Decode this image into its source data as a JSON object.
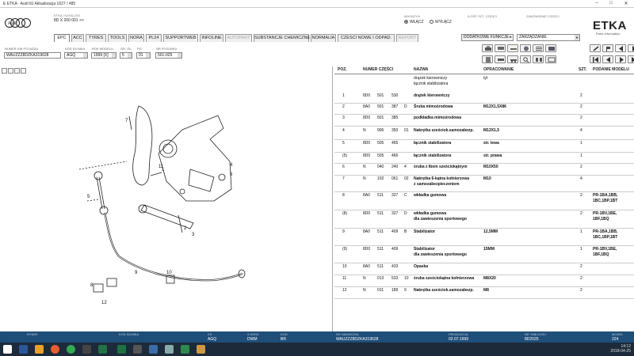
{
  "titlebar": {
    "text": "E ETKA · Audi 8J Aktualizacja 1627 / 485",
    "minimize": "–",
    "maximize": "□",
    "close": "✕"
  },
  "header": {
    "brand": "Audi",
    "model_label": "ETKA / KATALOGI",
    "model_value": "8D X 200 001 >>",
    "market_label": "MAGAZYN",
    "market_on": "WŁĄCZ",
    "market_off": "WYŁĄCZ",
    "parts_label": "ILOŚĆ SZT. CZĘŚCI",
    "order_label": "ZAMÓWIENIE CZĘŚCI",
    "etka_logo": "ETKA",
    "etka_sub": "Parts Information"
  },
  "tabs": [
    {
      "label": "EPC",
      "active": true
    },
    {
      "label": "ACC"
    },
    {
      "label": "TYRES"
    },
    {
      "label": "TOOLS"
    },
    {
      "label": "NORA"
    },
    {
      "label": "PL24"
    },
    {
      "label": "SUPPORTWEB"
    },
    {
      "label": "INFOLINE"
    },
    {
      "label": "AUTOPART",
      "disabled": true
    },
    {
      "label": "SUBSTANCJE CHEMICZNE"
    },
    {
      "label": "NORMALIA"
    },
    {
      "label": "CZESCI NOWE I ODPAD."
    },
    {
      "label": "REPORT",
      "disabled": true
    }
  ],
  "functions": {
    "label": "DODATKOWE FUNKCJE ▸",
    "manage": "ZARZĄDZANIE"
  },
  "filters": {
    "vin_label": "NUMER VIN POJAZDU",
    "vin_value": "WAUZZZ8DZKA319628",
    "engine_label": "KOD SILNIKA",
    "engine_value": "AGQ",
    "year_label": "ROK MODELU",
    "year_value": "1999 [X]",
    "group_label": "GR. GŁ.",
    "group_value": "5",
    "sub_label": "PG",
    "sub_value": "01",
    "illus_label": "NR RYSUNKU",
    "illus_value": "501-025"
  },
  "table": {
    "headers": {
      "pos": "POZ.",
      "part": "NUMER CZĘŚCI",
      "name": "NAZWA",
      "desc": "OPRACOWANIE",
      "qty": "SZT.",
      "model": "PODANIE MODELU"
    },
    "group_name": [
      "drążek kierowniczy",
      "łącznik stabilizatora"
    ],
    "group_desc": "tył",
    "rows": [
      {
        "pos": "1",
        "pre": "8D0",
        "mid": "501",
        "suf": "530",
        "idx": "",
        "name": [
          "drążek kierowniczy"
        ],
        "desc": "",
        "qty": "2",
        "model": [
          "",
          ""
        ]
      },
      {
        "pos": "2",
        "pre": "8A0",
        "mid": "501",
        "suf": "387",
        "idx": "D",
        "name": [
          "Śruba mimośrodowa"
        ],
        "desc": "M12X1,5X86",
        "qty": "2",
        "model": [
          "",
          ""
        ]
      },
      {
        "pos": "3",
        "pre": "8D0",
        "mid": "501",
        "suf": "385",
        "idx": "",
        "name": [
          "podkładka mimośrodowa"
        ],
        "desc": "",
        "qty": "2",
        "model": [
          "",
          ""
        ]
      },
      {
        "pos": "4",
        "pre": "N",
        "mid": "906",
        "suf": "350",
        "idx": "01",
        "name": [
          "Nakrętka sześciok.samozabezp."
        ],
        "desc": "M12X1,5",
        "qty": "4",
        "model": [
          "",
          ""
        ]
      },
      {
        "pos": "5",
        "pre": "8D0",
        "mid": "505",
        "suf": "465",
        "idx": "",
        "name": [
          "łącznik stabilizatora"
        ],
        "desc": "str. lewa",
        "qty": "1",
        "model": [
          "",
          ""
        ]
      },
      {
        "pos": "(5)",
        "pre": "8D0",
        "mid": "505",
        "suf": "466",
        "idx": "",
        "name": [
          "łącznik stabilizatora"
        ],
        "desc": "str. prawa",
        "qty": "1",
        "model": [
          "",
          ""
        ]
      },
      {
        "pos": "6",
        "pre": "N",
        "mid": "040",
        "suf": "240",
        "idx": "4",
        "name": [
          "śruba  z łbem sześciokątnym"
        ],
        "desc": "M10X50",
        "qty": "2",
        "model": [
          "",
          ""
        ]
      },
      {
        "pos": "7",
        "pre": "N",
        "mid": "102",
        "suf": "061",
        "idx": "02",
        "name": [
          "Nakrętka 6-kątna kołnierzowa",
          "z samozabezpieczeniem"
        ],
        "desc": "M10",
        "qty": "4",
        "model": [
          "",
          ""
        ]
      },
      {
        "pos": "8",
        "pre": "8A0",
        "mid": "511",
        "suf": "327",
        "idx": "C",
        "name": [
          "wkładka gumowa"
        ],
        "desc": "",
        "qty": "2",
        "model": [
          "PR-1BA,1BB,",
          "1BC,1BP,1BT"
        ]
      },
      {
        "pos": "(8)",
        "pre": "8D0",
        "mid": "511",
        "suf": "327",
        "idx": "D",
        "name": [
          "wkładka gumowa",
          "dla zawieszenia sportowego"
        ],
        "desc": "",
        "qty": "2",
        "model": [
          "PR-1BV,1BE,",
          "1BF,1BQ"
        ]
      },
      {
        "pos": "9",
        "pre": "8A0",
        "mid": "511",
        "suf": "409",
        "idx": "B",
        "name": [
          "Stabilizator"
        ],
        "desc": "12,5MM",
        "qty": "1",
        "model": [
          "PR-1BA,1BB,",
          "1BC,1BP,1BT"
        ]
      },
      {
        "pos": "(9)",
        "pre": "8D0",
        "mid": "511",
        "suf": "409",
        "idx": "",
        "name": [
          "Stabilizator",
          "dla zawieszenia sportowego"
        ],
        "desc": "15MM",
        "qty": "1",
        "model": [
          "PR-1BV,1BE,",
          "1BF,1BQ"
        ]
      },
      {
        "pos": "10",
        "pre": "8A0",
        "mid": "511",
        "suf": "433",
        "idx": "",
        "name": [
          "Opaska"
        ],
        "desc": "",
        "qty": "2",
        "model": [
          "",
          ""
        ]
      },
      {
        "pos": "11",
        "pre": "N",
        "mid": "013",
        "suf": "533",
        "idx": "10",
        "name": [
          "śruba sześciokątna kołnierzowa"
        ],
        "desc": "M8X20",
        "qty": "2",
        "model": [
          "",
          ""
        ]
      },
      {
        "pos": "12",
        "pre": "N",
        "mid": "011",
        "suf": "189",
        "idx": "9",
        "name": [
          "Nakrętka sześciok.samozabezp."
        ],
        "desc": "M8",
        "qty": "2",
        "model": [
          "",
          ""
        ]
      }
    ]
  },
  "illustration": {
    "callouts": [
      "1",
      "2",
      "3",
      "4",
      "5",
      "6",
      "7",
      "8",
      "9",
      "10",
      "11",
      "12"
    ]
  },
  "status": {
    "fields": [
      {
        "label": "RYNEK",
        "value": ""
      },
      {
        "label": "KOD SILNIKA",
        "value": ""
      },
      {
        "label": "",
        "value": ""
      },
      {
        "label": "KS",
        "value": "AGQ"
      },
      {
        "label": "S.SKRZ.",
        "value": "DWM"
      },
      {
        "label": "KOD",
        "value": "BR"
      },
      {
        "label": "NR NADWOZIA",
        "value": "WAUZZZ8DZKA319628"
      },
      {
        "label": "PRODUKCJA",
        "value": "02.07.1999"
      },
      {
        "label": "NR TABLICZKI",
        "value": "8D2025"
      },
      {
        "label": "MODEL",
        "value": "224"
      }
    ]
  },
  "taskbar": {
    "time": "14:12",
    "date": "2018-04-25"
  }
}
